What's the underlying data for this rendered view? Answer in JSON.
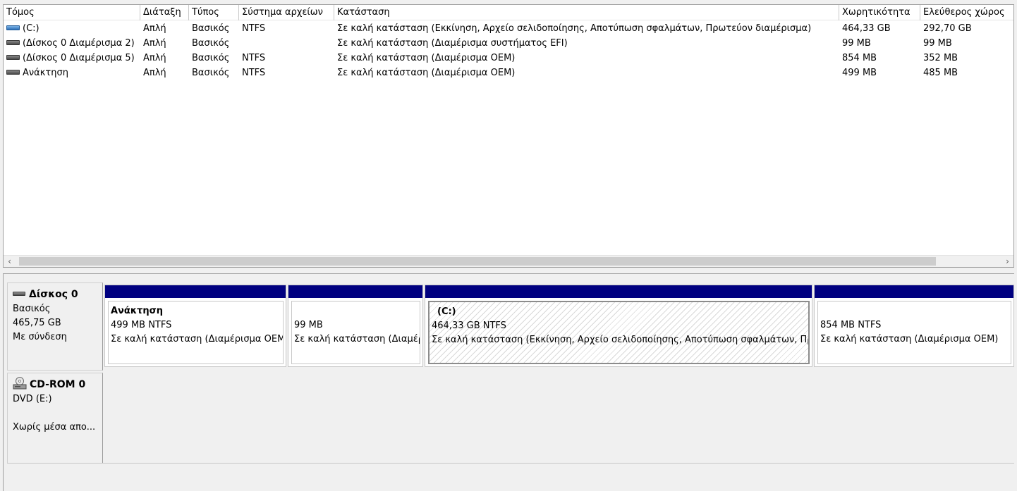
{
  "columns": [
    "Τόμος",
    "Διάταξη",
    "Τύπος",
    "Σύστημα αρχείων",
    "Κατάσταση",
    "Χωρητικότητα",
    "Ελεύθερος χώρος"
  ],
  "volumes": [
    {
      "name": "(C:)",
      "layout": "Απλή",
      "type": "Βασικός",
      "fs": "NTFS",
      "status": "Σε καλή κατάσταση (Εκκίνηση, Αρχείο σελιδοποίησης, Αποτύπωση σφαλμάτων, Πρωτεύον διαμέρισμα)",
      "capacity": "464,33 GB",
      "free": "292,70 GB",
      "icon": "blue-volume-icon"
    },
    {
      "name": "(Δίσκος 0 Διαμέρισμα 2)",
      "layout": "Απλή",
      "type": "Βασικός",
      "fs": "",
      "status": "Σε καλή κατάσταση (Διαμέρισμα συστήματος EFI)",
      "capacity": "99 MB",
      "free": "99 MB",
      "icon": "gray-volume-icon"
    },
    {
      "name": "(Δίσκος 0 Διαμέρισμα 5)",
      "layout": "Απλή",
      "type": "Βασικός",
      "fs": "NTFS",
      "status": "Σε καλή κατάσταση (Διαμέρισμα OEM)",
      "capacity": "854 MB",
      "free": "352 MB",
      "icon": "gray-volume-icon"
    },
    {
      "name": "Ανάκτηση",
      "layout": "Απλή",
      "type": "Βασικός",
      "fs": "NTFS",
      "status": "Σε καλή κατάσταση (Διαμέρισμα OEM)",
      "capacity": "499 MB",
      "free": "485 MB",
      "icon": "gray-volume-icon"
    }
  ],
  "scroll": {
    "left_arrow": "‹",
    "right_arrow": "›"
  },
  "disk0": {
    "title": "Δίσκος 0",
    "type": "Βασικός",
    "size": "465,75 GB",
    "status": "Με σύνδεση",
    "partitions": [
      {
        "name": "Ανάκτηση",
        "size": "499 MB NTFS",
        "status": "Σε καλή κατάσταση (Διαμέρισμα OEM)"
      },
      {
        "name": "",
        "size": "99 MB",
        "status": "Σε καλή κατάσταση (Διαμέρισμα συστήματος EFI)"
      },
      {
        "name": "(C:)",
        "size": "464,33 GB NTFS",
        "status": "Σε καλή κατάσταση (Εκκίνηση, Αρχείο σελιδοποίησης, Αποτύπωση σφαλμάτων, Πρωτεύον διαμέρισμα)"
      },
      {
        "name": "",
        "size": "854 MB NTFS",
        "status": "Σε καλή κατάσταση (Διαμέρισμα OEM)"
      }
    ]
  },
  "cdrom0": {
    "title": "CD-ROM 0",
    "drive": "DVD (E:)",
    "media": "Χωρίς μέσα απο..."
  },
  "colors": {
    "partition_bar": "#000080",
    "volume_blue": "#2d6fb8"
  }
}
